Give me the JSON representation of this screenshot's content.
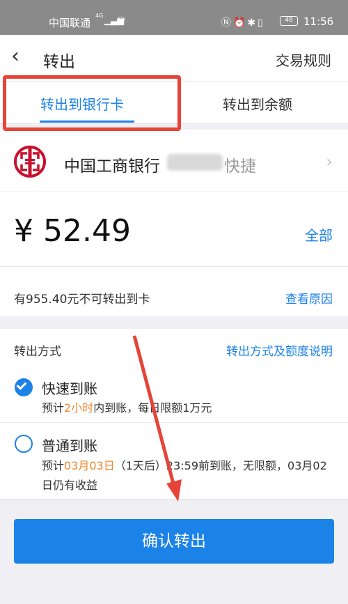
{
  "status_bar": {
    "carrier": "中国联通",
    "network": "4G",
    "battery": "48",
    "time": "11:56"
  },
  "header": {
    "back_icon": "chevron-left-icon",
    "title": "转出",
    "rules_link": "交易规则"
  },
  "tabs": [
    {
      "label": "转出到银行卡",
      "active": true
    },
    {
      "label": "转出到余额",
      "active": false
    }
  ],
  "bank": {
    "logo_icon": "icbc-logo-icon",
    "name": "中国工商银行",
    "tag": "快捷"
  },
  "amount": {
    "value": "¥ 52.49",
    "all_label": "全部"
  },
  "notice": {
    "text": "有955.40元不可转出到卡",
    "link": "查看原因"
  },
  "method": {
    "label": "转出方式",
    "explain_link": "转出方式及额度说明",
    "options": [
      {
        "title": "快速到账",
        "selected": true,
        "desc_prefix": "预计",
        "desc_highlight": "2小时",
        "desc_suffix": "内到账，每日限额1万元"
      },
      {
        "title": "普通到账",
        "selected": false,
        "desc_prefix": "预计",
        "desc_highlight": "03月03日",
        "desc_suffix": "（1天后）23:59前到账，无限额，03月02日仍有收益"
      }
    ]
  },
  "confirm_button": "确认转出",
  "colors": {
    "accent": "#1b82e8",
    "highlight": "#f0862d",
    "annotation_red": "#e64438"
  }
}
